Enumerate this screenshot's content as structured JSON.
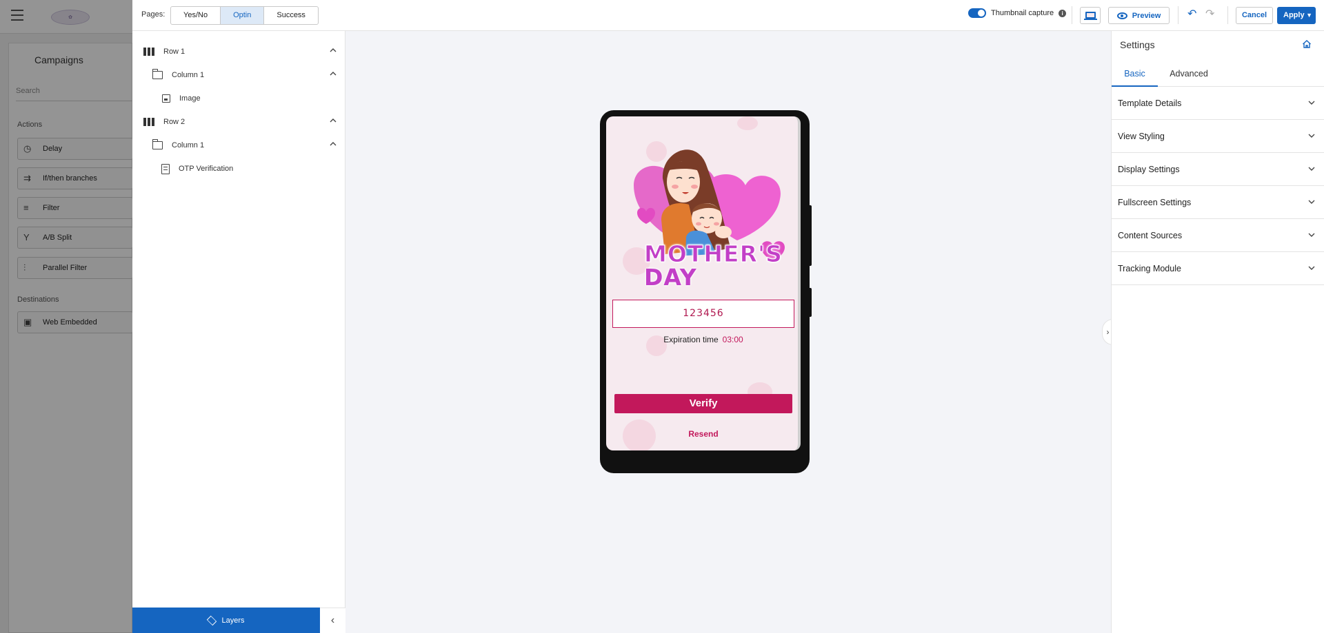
{
  "background_app": {
    "campaigns_title": "Campaigns",
    "search_placeholder": "Search",
    "actions_label": "Actions",
    "actions": [
      "Delay",
      "If/then branches",
      "Filter",
      "A/B Split",
      "Parallel Filter"
    ],
    "destinations_label": "Destinations",
    "destinations": [
      "Web Embedded"
    ]
  },
  "topbar": {
    "pages_label": "Pages:",
    "pages": [
      "Yes/No",
      "Optin",
      "Success"
    ],
    "active_page": "Optin",
    "thumbnail_label": "Thumbnail capture",
    "thumbnail_on": true,
    "preview_label": "Preview",
    "cancel_label": "Cancel",
    "apply_label": "Apply"
  },
  "layers": {
    "tree": [
      {
        "label": "Row 1",
        "type": "row"
      },
      {
        "label": "Column 1",
        "type": "column"
      },
      {
        "label": "Image",
        "type": "image"
      },
      {
        "label": "Row 2",
        "type": "row"
      },
      {
        "label": "Column 1",
        "type": "column"
      },
      {
        "label": "OTP Verification",
        "type": "form"
      }
    ],
    "tab_label": "Layers"
  },
  "preview": {
    "title_line1": "MOTHER'S",
    "title_line2": "DAY",
    "otp_value": "123456",
    "expiration_label": "Expiration time",
    "expiration_time": "03:00",
    "verify_label": "Verify",
    "resend_label": "Resend"
  },
  "settings": {
    "title": "Settings",
    "tabs": [
      "Basic",
      "Advanced"
    ],
    "active_tab": "Basic",
    "sections": [
      "Template Details",
      "View Styling",
      "Display Settings",
      "Fullscreen Settings",
      "Content Sources",
      "Tracking Module"
    ]
  },
  "colors": {
    "accent": "#1565c0",
    "brand": "#c2185b",
    "title_magenta": "#c23fc7"
  }
}
